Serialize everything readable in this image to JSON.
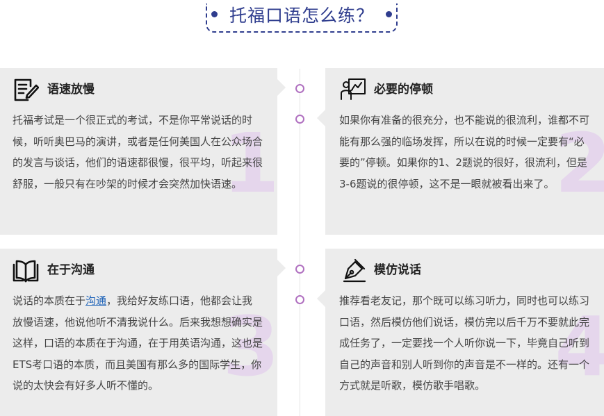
{
  "header": {
    "title": "托福口语怎么练？"
  },
  "cards": [
    {
      "title": "语速放慢",
      "icon": "note-pen-icon",
      "number": "1",
      "body": "托福考试是一个很正式的考试，不是你平常说话的时候，听听奥巴马的演讲，或者是任何美国人在公众场合的发言与谈话，他们的语速都很慢，很平均，听起来很舒服，一般只有在吵架的时候才会突然加快语速。"
    },
    {
      "title": "必要的停顿",
      "icon": "speaker-board-icon",
      "number": "2",
      "body": "如果你有准备的很充分，也不能说的很流利，谁都不可能有那么强的临场发挥，所以在说的时候一定要有“必要的”停顿。如果你的1、2题说的很好，很流利，但是3-6题说的很停顿，这不是一眼就被看出来了。"
    },
    {
      "title": "在于沟通",
      "icon": "open-book-icon",
      "number": "3",
      "body_before": "说话的本质在于",
      "link": "沟通",
      "body_after": "，我给好友练口语，他都会让我放慢语速，他说他听不清我说什么。后来我想想确实是这样，口语的本质在于沟通，在于用英语沟通，这也是ETS考口语的本质，而且美国有那么多的国际学生，你说的太快会有好多人听不懂的。"
    },
    {
      "title": "模仿说话",
      "icon": "fountain-pen-icon",
      "number": "4",
      "body": "推荐看老友记，那个既可以练习听力，同时也可以练习口语，然后模仿他们说话，模仿完以后千万不要就此完成任务了，一定要找一个人听你说一下，毕竟自己听到自己的声音和别人听到你的声音是不一样的。还有一个方式就是听歌，模仿歌手唱歌。"
    }
  ],
  "colors": {
    "accent": "#2f3d8e",
    "card_bg": "#ececec",
    "timeline_dot": "#b070c0",
    "numeral": "#e5d6ec",
    "link": "#1f63b8"
  }
}
